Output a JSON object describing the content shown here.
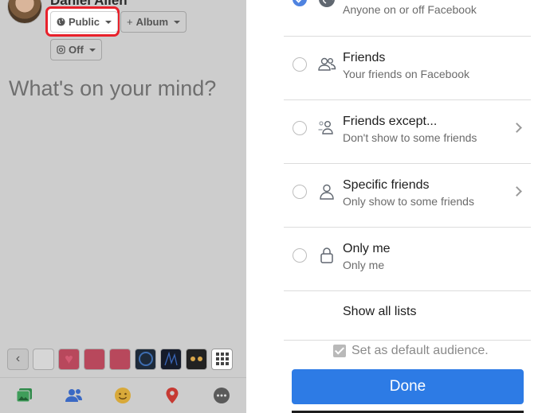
{
  "composer": {
    "user_name": "Daniel Allen",
    "audience_button": "Public",
    "album_button": "Album",
    "album_prefix": "+",
    "instagram_button": "Off",
    "placeholder": "What's on your mind?",
    "back_glyph": "‹",
    "backgrounds": [
      "white",
      "heart",
      "red",
      "red",
      "dark-circle",
      "dark-lines",
      "eyes",
      "grid"
    ],
    "toolbar_icons": [
      "photo-icon",
      "tag-people-icon",
      "feeling-icon",
      "location-icon",
      "more-icon"
    ],
    "highlight_color": "#e8212b"
  },
  "audience": {
    "options": [
      {
        "title": "",
        "subtitle": "Anyone on or off Facebook",
        "icon": "globe-icon",
        "selected": true,
        "has_chevron": false
      },
      {
        "title": "Friends",
        "subtitle": "Your friends on Facebook",
        "icon": "friends-icon",
        "selected": false,
        "has_chevron": false
      },
      {
        "title": "Friends except...",
        "subtitle": "Don't show to some friends",
        "icon": "friends-except-icon",
        "selected": false,
        "has_chevron": true
      },
      {
        "title": "Specific friends",
        "subtitle": "Only show to some friends",
        "icon": "person-icon",
        "selected": false,
        "has_chevron": true
      },
      {
        "title": "Only me",
        "subtitle": "Only me",
        "icon": "lock-icon",
        "selected": false,
        "has_chevron": false
      }
    ],
    "show_all_lists": "Show all lists",
    "default_label": "Set as default audience.",
    "default_checked": true,
    "done_label": "Done",
    "accent_color": "#2d7be5"
  }
}
